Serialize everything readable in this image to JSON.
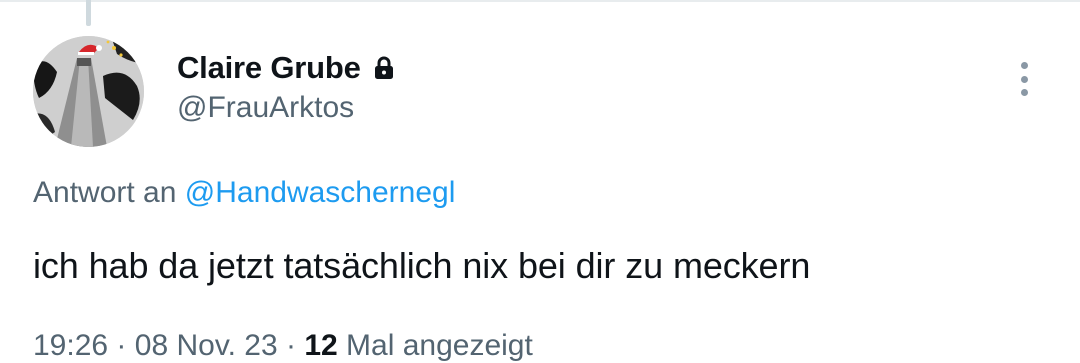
{
  "tweet": {
    "display_name": "Claire Grube",
    "handle": "@FrauArktos",
    "protected_icon": "lock-icon",
    "reply_prefix": "Antwort an",
    "reply_mention": "@Handwaschernegl",
    "text": "ich hab da jetzt tatsächlich nix bei dir zu meckern",
    "time": "19:26",
    "separator": "·",
    "date": "08 Nov. 23",
    "views_count": "12",
    "views_label": "Mal angezeigt"
  },
  "colors": {
    "primary_text": "#0f1419",
    "secondary_text": "#536471",
    "link": "#1d9bf0",
    "thread_line": "#cfd9de"
  },
  "icons": [
    "lock-icon",
    "more-options-icon"
  ]
}
